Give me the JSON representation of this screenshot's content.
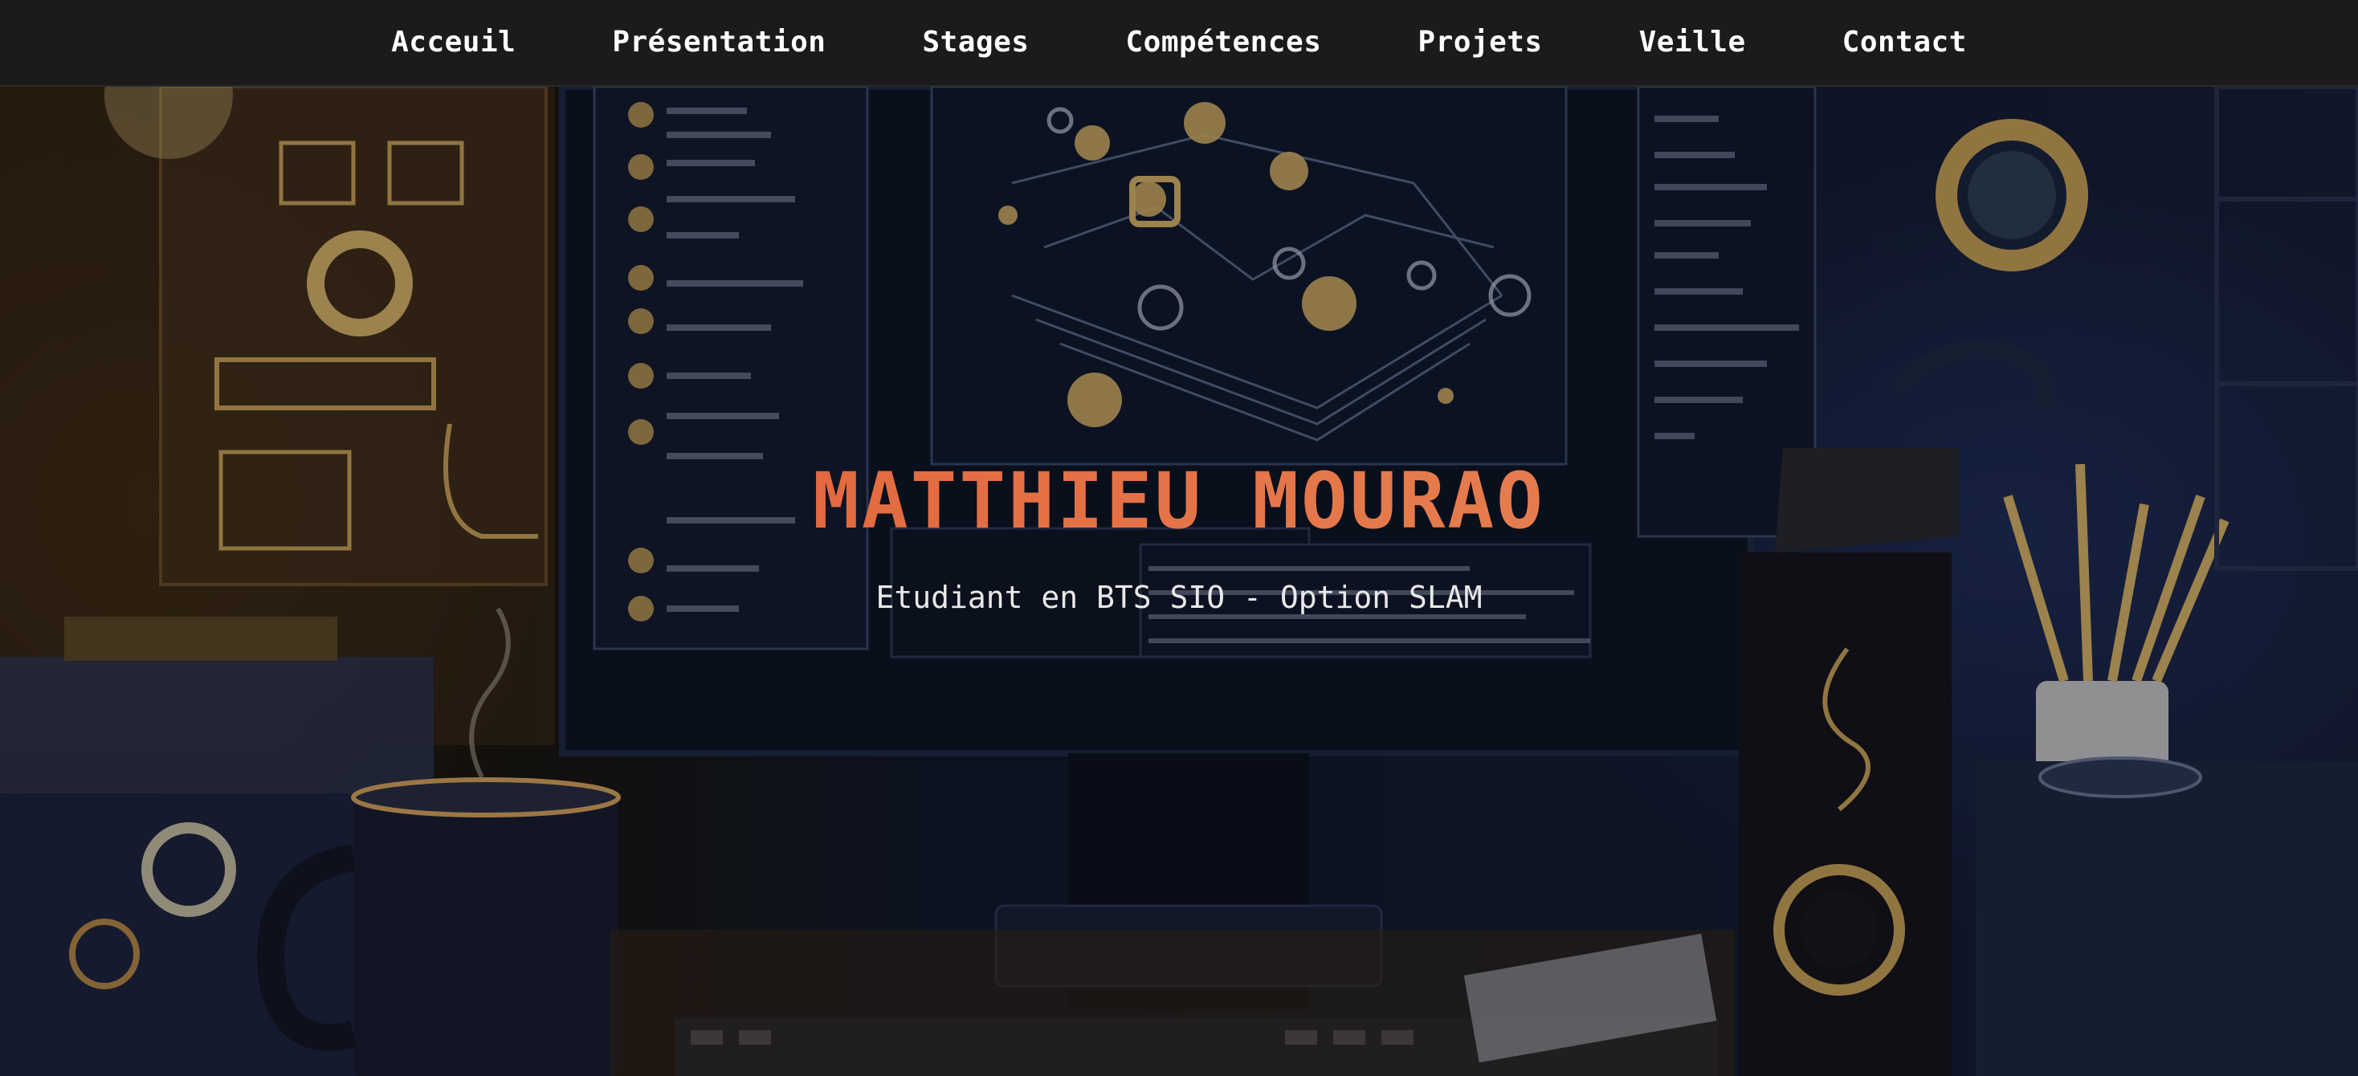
{
  "nav": {
    "items": [
      {
        "label": "Acceuil"
      },
      {
        "label": "Présentation"
      },
      {
        "label": "Stages"
      },
      {
        "label": "Compétences"
      },
      {
        "label": "Projets"
      },
      {
        "label": "Veille"
      },
      {
        "label": "Contact"
      }
    ]
  },
  "hero": {
    "title": "MATTHIEU MOURAO",
    "subtitle": "Etudiant en BTS SIO - Option SLAM"
  },
  "colors": {
    "navbar_bg": "#1b1b1b",
    "title_accent": "#e0643c",
    "text": "#ffffff"
  }
}
